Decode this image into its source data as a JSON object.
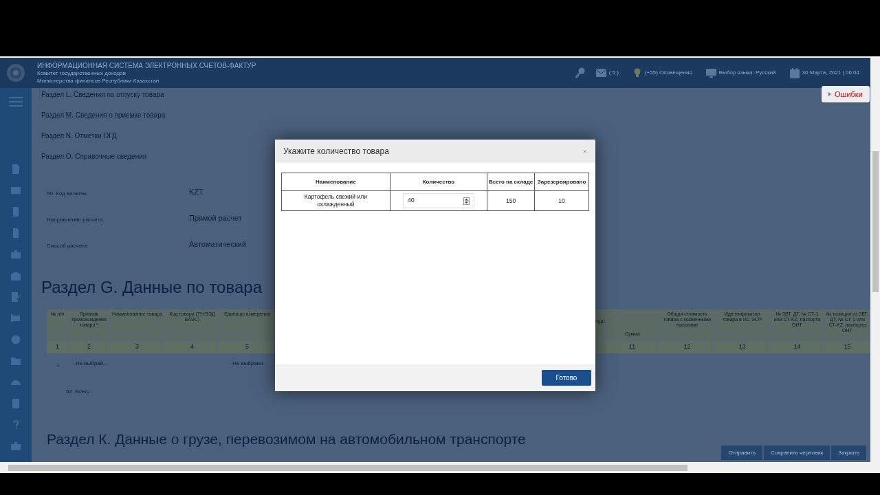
{
  "header": {
    "title": "ИНФОРМАЦИОННАЯ СИСТЕМА ЭЛЕКТРОННЫХ СЧЕТОВ-ФАКТУР",
    "subtitle_1": "Комитет государственных доходов",
    "subtitle_2": "Министерства финансов Республики Казахстан",
    "messages": "( 5 )",
    "notifications": "(+55) Оповещения",
    "language": "Выбор языка: Русский",
    "datetime": "30 Марта, 2021 | 06:04"
  },
  "errors_button": "Ошибки",
  "section_links": [
    "Раздел L. Сведения по отпуску товара",
    "Раздел M. Сведения о приемке товара",
    "Раздел N. Отметки ОГД",
    "Раздел O. Справочные сведения"
  ],
  "fields": [
    {
      "label": "50. Код валюты",
      "value": "KZT"
    },
    {
      "label": "Направление расчета",
      "value": "Прямой расчет"
    },
    {
      "label": "Способ расчета",
      "value": "Автоматический"
    }
  ],
  "goods_section": {
    "heading": "Раздел G. Данные по товара",
    "left_columns": [
      {
        "label": "№ п/п",
        "number": "1"
      },
      {
        "label": "Признак происхождения товара *",
        "number": "2"
      },
      {
        "label": "Наименование товара",
        "number": "3"
      },
      {
        "label": "Код товара (ТН ВЭД ЕАЭС)",
        "number": "4"
      },
      {
        "label": "Единицы измерения",
        "number": "5"
      }
    ],
    "group_label": "НДС",
    "right_columns": [
      {
        "label": "Сумма",
        "number": "11"
      },
      {
        "label": "Общая стоимость товара с косвенными налогами",
        "number": "12"
      },
      {
        "label": "Идентификатор товара в ИС ЭСФ",
        "number": "13"
      },
      {
        "label": "№ ЗВТ, ДТ, № СТ-1 или СТ-KZ, паспорта ОНТ",
        "number": "14"
      },
      {
        "label": "№ позиции из ЗВТ, ДТ, № СТ-1 или СТ-KZ, паспорта ОНТ",
        "number": "15"
      }
    ],
    "row": {
      "number": "1",
      "origin": "- Не выбрай...",
      "unit": "- Не выбрано -"
    },
    "total_label": "52. Всего"
  },
  "transport_heading": "Раздел К. Данные о грузе, перевозимом на автомобильном транспорте",
  "footer_buttons": [
    "Отправить",
    "Сохранить черновик",
    "Закрыть"
  ],
  "modal": {
    "title": "Укажите количество товара",
    "close": "×",
    "columns": [
      "Наименование",
      "Количество",
      "Всего на складе",
      "Зарезервировано"
    ],
    "rows": [
      {
        "name": "Картофель свежий или охлажденный",
        "quantity": "40",
        "stock": "150",
        "reserved": "10"
      }
    ],
    "done_button": "Готово"
  }
}
